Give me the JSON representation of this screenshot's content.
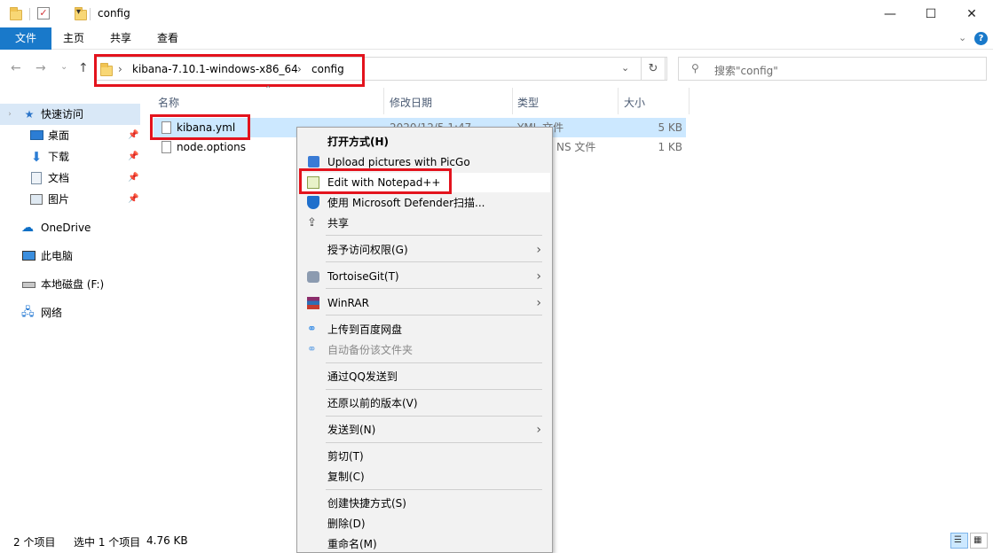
{
  "window": {
    "title": "config",
    "controls": {
      "minimize": "—",
      "maximize": "☐",
      "close": "✕"
    }
  },
  "ribbon": {
    "tabs": [
      {
        "label": "文件"
      },
      {
        "label": "主页"
      },
      {
        "label": "共享"
      },
      {
        "label": "查看"
      }
    ]
  },
  "address": {
    "crumbs": [
      {
        "label": "kibana-7.10.1-windows-x86_64"
      },
      {
        "label": "config"
      }
    ],
    "search_placeholder": "搜索\"config\""
  },
  "sidebar": {
    "items": [
      {
        "label": "快速访问",
        "icon": "star-icon",
        "pinned": false
      },
      {
        "label": "桌面",
        "icon": "desktop-icon",
        "pinned": true
      },
      {
        "label": "下载",
        "icon": "download-icon",
        "pinned": true
      },
      {
        "label": "文档",
        "icon": "document-icon",
        "pinned": true
      },
      {
        "label": "图片",
        "icon": "pictures-icon",
        "pinned": true
      },
      {
        "label": "OneDrive",
        "icon": "cloud-icon",
        "pinned": false
      },
      {
        "label": "此电脑",
        "icon": "computer-icon",
        "pinned": false
      },
      {
        "label": "本地磁盘 (F:)",
        "icon": "drive-icon",
        "pinned": false
      },
      {
        "label": "网络",
        "icon": "network-icon",
        "pinned": false
      }
    ]
  },
  "columns": {
    "name": "名称",
    "date": "修改日期",
    "type": "类型",
    "size": "大小"
  },
  "files": [
    {
      "name": "kibana.yml",
      "date": "2020/12/5 1:47",
      "type": "YML 文件",
      "size": "5 KB"
    },
    {
      "name": "node.options",
      "date": "",
      "type": "NS 文件",
      "size": "1 KB"
    }
  ],
  "context_menu": {
    "items": [
      {
        "label": "打开方式(H)"
      },
      {
        "label": "Upload pictures with PicGo"
      },
      {
        "label": "Edit with Notepad++"
      },
      {
        "label": "使用 Microsoft Defender扫描..."
      },
      {
        "label": "共享"
      },
      {
        "label": "授予访问权限(G)"
      },
      {
        "label": "TortoiseGit(T)"
      },
      {
        "label": "WinRAR"
      },
      {
        "label": "上传到百度网盘"
      },
      {
        "label": "自动备份该文件夹"
      },
      {
        "label": "通过QQ发送到"
      },
      {
        "label": "还原以前的版本(V)"
      },
      {
        "label": "发送到(N)"
      },
      {
        "label": "剪切(T)"
      },
      {
        "label": "复制(C)"
      },
      {
        "label": "创建快捷方式(S)"
      },
      {
        "label": "删除(D)"
      },
      {
        "label": "重命名(M)"
      }
    ]
  },
  "status": {
    "item_count": "2 个项目",
    "selection": "选中 1 个项目",
    "selection_size": "4.76 KB"
  },
  "colors": {
    "accent": "#1979ca",
    "highlight": "#e3131d",
    "selection": "#cce8ff"
  }
}
